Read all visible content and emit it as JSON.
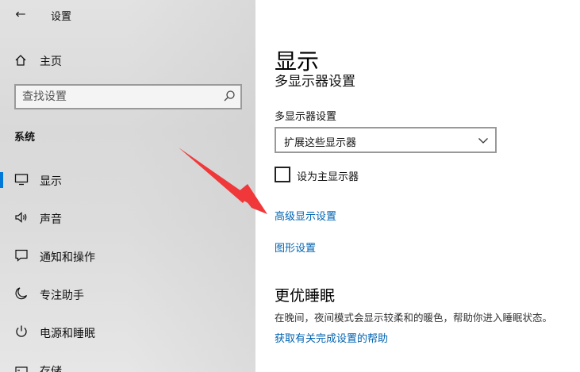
{
  "window": {
    "title": "设置"
  },
  "sidebar": {
    "home_label": "主页",
    "search": {
      "placeholder": "查找设置"
    },
    "section_label": "系统",
    "items": [
      {
        "label": "显示",
        "icon": "monitor-icon",
        "active": true
      },
      {
        "label": "声音",
        "icon": "speaker-icon"
      },
      {
        "label": "通知和操作",
        "icon": "notification-icon"
      },
      {
        "label": "专注助手",
        "icon": "moon-icon"
      },
      {
        "label": "电源和睡眠",
        "icon": "power-icon"
      },
      {
        "label": "存储",
        "icon": "storage-icon"
      }
    ]
  },
  "main": {
    "title": "显示",
    "clipped_heading": "多显示器设置",
    "multi_display": {
      "label": "多显示器设置",
      "selected": "扩展这些显示器"
    },
    "primary_checkbox": {
      "label": "设为主显示器",
      "checked": false
    },
    "links": {
      "advanced": "高级显示设置",
      "graphics": "图形设置"
    },
    "sleep_section": {
      "title": "更优睡眠",
      "description": "在晚间，夜间模式会显示较柔和的暖色，帮助你进入睡眠状态。",
      "help_link": "获取有关完成设置的帮助"
    }
  },
  "colors": {
    "accent": "#0078d7",
    "link": "#0063b1",
    "annotation_arrow": "#f0383b"
  }
}
